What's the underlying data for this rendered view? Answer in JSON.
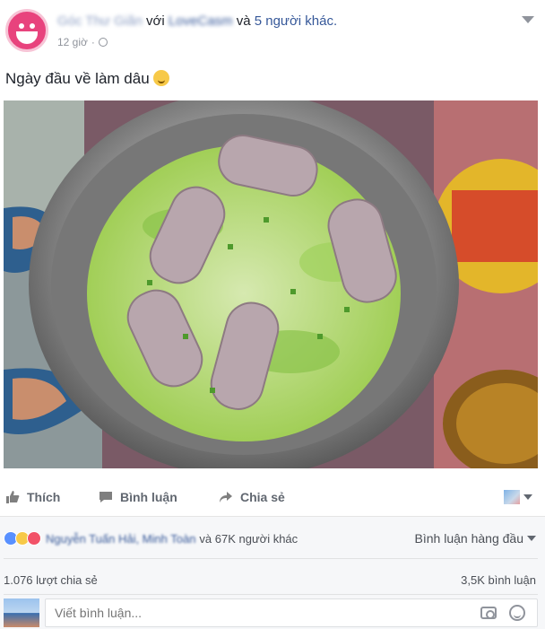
{
  "post": {
    "author_name": "Góc Thư Giãn",
    "with_word": "với",
    "tagged_page": "LoveCasm",
    "and_word": "và",
    "others": "5 người khác.",
    "time": "12 giờ",
    "separator": "·",
    "text": "Ngày đầu về làm dâu"
  },
  "actions": {
    "like": "Thích",
    "comment": "Bình luận",
    "share": "Chia sẻ"
  },
  "reactions": {
    "names": "Nguyễn Tuấn Hải, Minh Toàn",
    "rest": "và 67K người khác",
    "top_comments": "Bình luận hàng đầu"
  },
  "stats": {
    "shares": "1.076 lượt chia sẻ",
    "comments": "3,5K bình luận"
  },
  "composer": {
    "placeholder": "Viết bình luận..."
  },
  "icons": {
    "like": "thumbs-up-icon",
    "comment": "speech-bubble-icon",
    "share": "share-arrow-icon",
    "camera": "camera-icon",
    "emoji": "smiley-icon"
  },
  "colors": {
    "link": "#365899",
    "muted": "#90949c",
    "like_reaction": "#5890ff",
    "haha_reaction": "#f7c948",
    "love_reaction": "#f25268"
  }
}
